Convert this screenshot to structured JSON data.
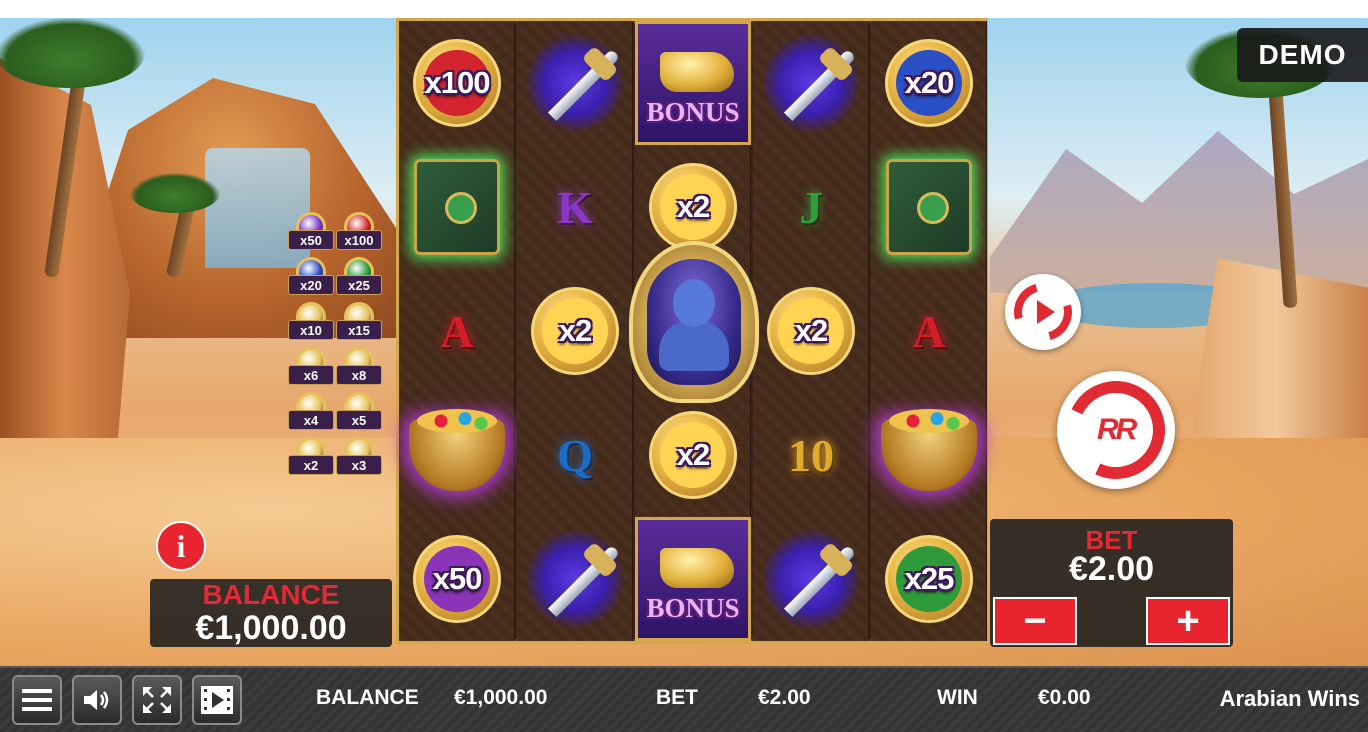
{
  "demo_label": "DEMO",
  "reels": [
    [
      "x100",
      "book",
      "A",
      "pot",
      "x50"
    ],
    [
      "dagger",
      "K",
      "x2",
      "Q",
      "dagger"
    ],
    [
      "BONUS",
      "x2",
      "genie",
      "x2",
      "BONUS"
    ],
    [
      "dagger",
      "J",
      "x2",
      "10",
      "dagger"
    ],
    [
      "x20",
      "book",
      "A",
      "pot",
      "x25"
    ]
  ],
  "coin_colors": {
    "x100": "#d2242f",
    "x50": "#8a35b7",
    "x20": "#2a4fc4",
    "x25": "#2f9a3a",
    "x2": "#ffd452"
  },
  "letter_colors": {
    "A": "#d51c2a",
    "K": "#8b37c6",
    "Q": "#1b6dc4",
    "J": "#2f9e3b",
    "10": "#e2aa2b"
  },
  "bonus_label": "BONUS",
  "multiplier_table": [
    {
      "label": "x50",
      "gem": "#7a35c8"
    },
    {
      "label": "x100",
      "gem": "#d2242f"
    },
    {
      "label": "x20",
      "gem": "#2a4fc4"
    },
    {
      "label": "x25",
      "gem": "#2f9a3a"
    },
    {
      "label": "x10",
      "gem": "#e7c25c"
    },
    {
      "label": "x15",
      "gem": "#e7c25c"
    },
    {
      "label": "x6",
      "gem": "#e7c25c"
    },
    {
      "label": "x8",
      "gem": "#e7c25c"
    },
    {
      "label": "x4",
      "gem": "#e7c25c"
    },
    {
      "label": "x5",
      "gem": "#e7c25c"
    },
    {
      "label": "x2",
      "gem": "#e7c25c"
    },
    {
      "label": "x3",
      "gem": "#e7c25c"
    }
  ],
  "info_label": "i",
  "balance_panel": {
    "label": "BALANCE",
    "value": "€1,000.00"
  },
  "bet_panel": {
    "label": "BET",
    "value": "€2.00",
    "minus": "−",
    "plus": "+"
  },
  "spin_button_label": "RR",
  "accent_color": "#e12a33",
  "bottom_bar": {
    "balance_label": "BALANCE",
    "balance_value": "€1,000.00",
    "bet_label": "BET",
    "bet_value": "€2.00",
    "win_label": "WIN",
    "win_value": "€0.00",
    "game_title": "Arabian Wins",
    "icons": [
      "menu-icon",
      "sound-icon",
      "fullscreen-icon",
      "video-icon"
    ]
  }
}
